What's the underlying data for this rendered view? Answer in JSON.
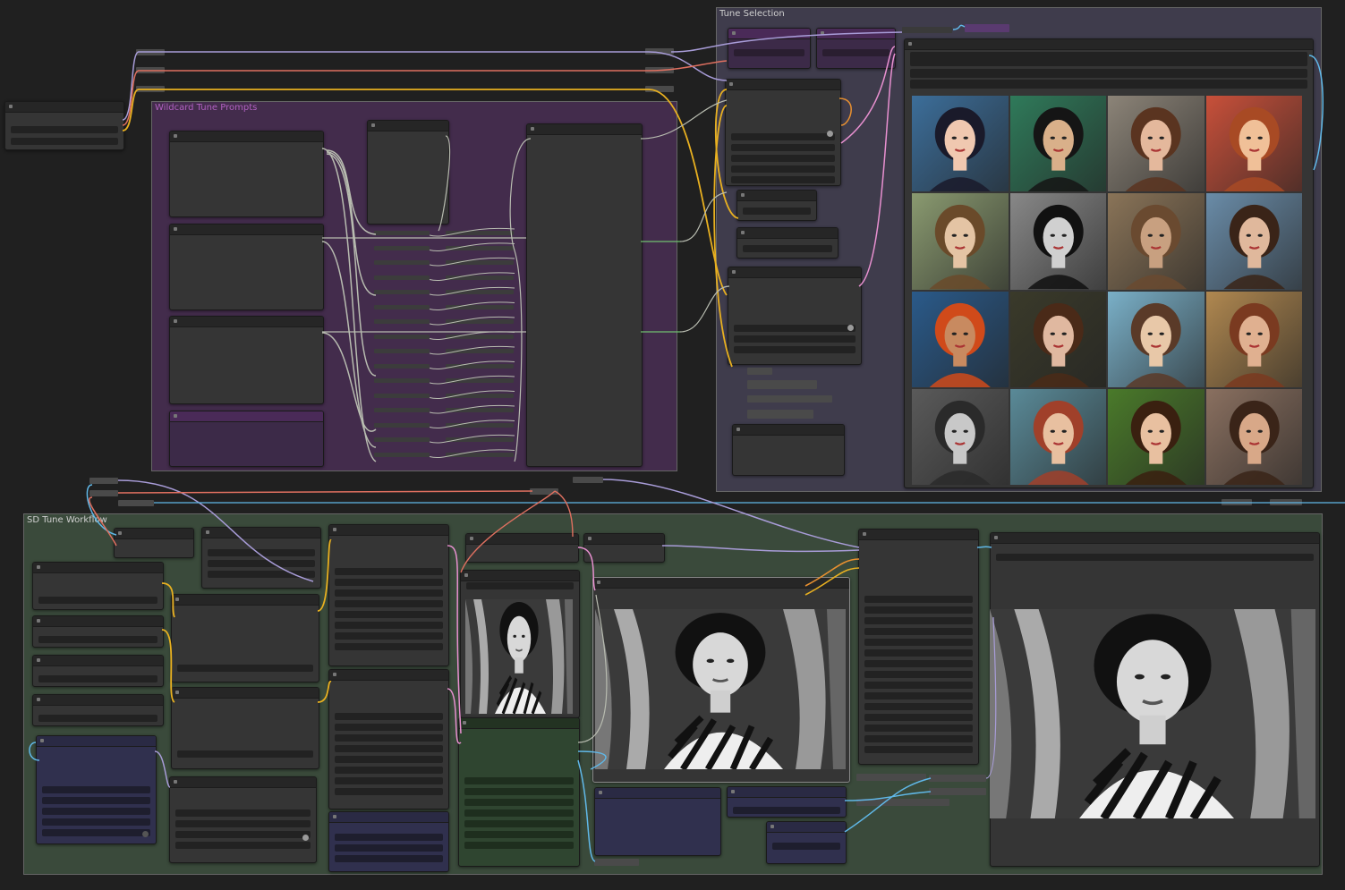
{
  "canvas_background": "#202020",
  "groups": {
    "tune_selection": {
      "title": "Tune Selection",
      "color": "#3f3c4c",
      "title_color": "#cfcfcf"
    },
    "wildcard": {
      "title": "Wildcard Tune Prompts",
      "color": "#432c4c",
      "title_color": "#b060c0"
    },
    "sd_tune": {
      "title": "SD Tune Workflow",
      "color": "#3a4a3b",
      "title_color": "#cfcfcf"
    }
  },
  "wire_colors": {
    "lavender": "#a89cd8",
    "salmon": "#e07060",
    "yellow": "#e8b020",
    "cyan": "#60b8e8",
    "pink": "#e890d0",
    "gray": "#b8bcb0",
    "orange": "#e89030",
    "green": "#70c070"
  },
  "gallery": {
    "rows": 4,
    "cols": 4,
    "tiles": [
      {
        "name": "portrait-blue-hair-flowers",
        "bg": "#3c6e9a",
        "skin": "#f0c8b0",
        "hair": "#1a1a2a"
      },
      {
        "name": "portrait-green-mosaic",
        "bg": "#2f7a5a",
        "skin": "#d9b08a",
        "hair": "#151515"
      },
      {
        "name": "portrait-blazer-woman",
        "bg": "#8c8478",
        "skin": "#e4b89c",
        "hair": "#5a3420"
      },
      {
        "name": "portrait-art-deco",
        "bg": "#c8503a",
        "skin": "#f0c098",
        "hair": "#a84a24"
      },
      {
        "name": "portrait-impressionist-garden",
        "bg": "#8a9a70",
        "skin": "#e4c4a4",
        "hair": "#6a4a2a"
      },
      {
        "name": "portrait-black-white-stripes",
        "bg": "#888888",
        "skin": "#d0d0d0",
        "hair": "#111111"
      },
      {
        "name": "portrait-sepia-woman",
        "bg": "#8a7458",
        "skin": "#c8a080",
        "hair": "#6a4a30"
      },
      {
        "name": "portrait-cubist-blue-dress",
        "bg": "#6a8ca8",
        "skin": "#e0b89c",
        "hair": "#3a2418"
      },
      {
        "name": "portrait-red-turban",
        "bg": "#2a5a8a",
        "skin": "#c88a60",
        "hair": "#d04a1a"
      },
      {
        "name": "portrait-victorian-lady",
        "bg": "#3a3a2a",
        "skin": "#e0b8a0",
        "hair": "#4a2a18"
      },
      {
        "name": "portrait-seaside-pool",
        "bg": "#7ab0c8",
        "skin": "#e8c8a8",
        "hair": "#5a3a28"
      },
      {
        "name": "portrait-deco-seated",
        "bg": "#b08850",
        "skin": "#e0b090",
        "hair": "#7a3a20"
      },
      {
        "name": "portrait-pencil-curls",
        "bg": "#5a5a5a",
        "skin": "#c8c8c8",
        "hair": "#2a2a2a"
      },
      {
        "name": "portrait-red-hair-painting",
        "bg": "#5a8a98",
        "skin": "#e8c0a0",
        "hair": "#a0402a"
      },
      {
        "name": "portrait-green-gold-ornate",
        "bg": "#4a7a2a",
        "skin": "#e8c0a0",
        "hair": "#3a2010"
      },
      {
        "name": "portrait-curly-brown-hair",
        "bg": "#8a7060",
        "skin": "#d8a888",
        "hair": "#3a2418"
      }
    ]
  }
}
